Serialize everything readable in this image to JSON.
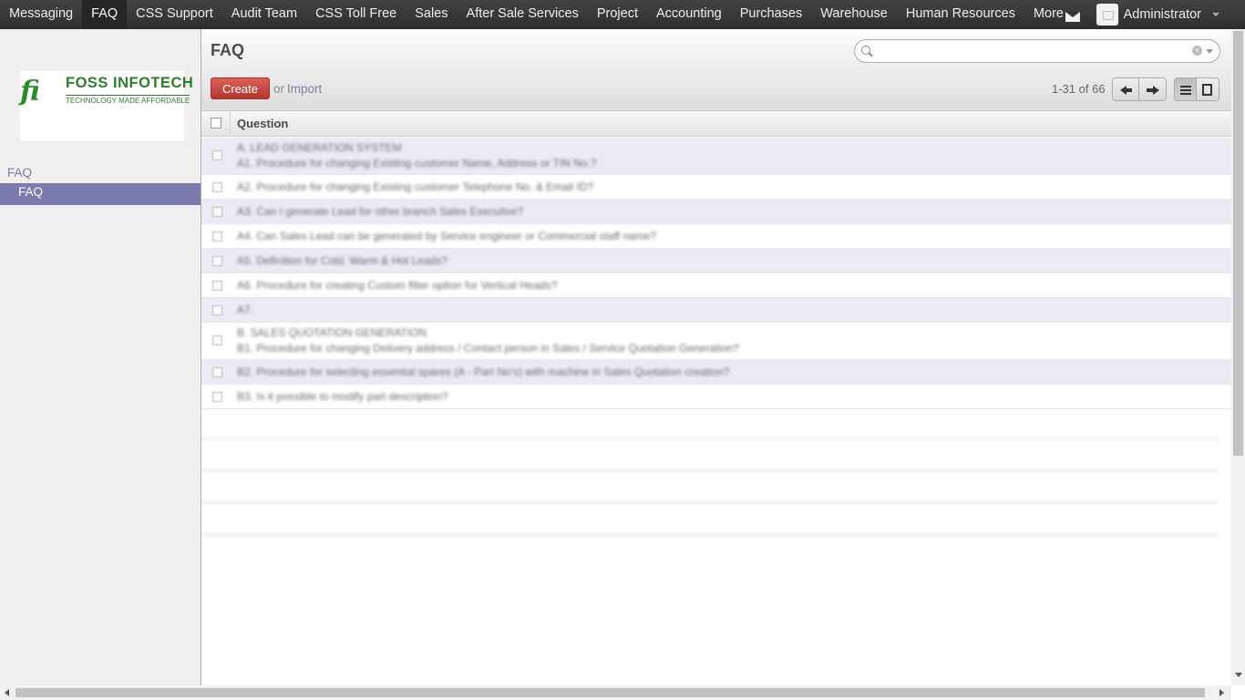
{
  "topbar": {
    "menu": [
      {
        "label": "Messaging",
        "active": false
      },
      {
        "label": "FAQ",
        "active": true
      },
      {
        "label": "CSS Support",
        "active": false
      },
      {
        "label": "Audit Team",
        "active": false
      },
      {
        "label": "CSS Toll Free",
        "active": false
      },
      {
        "label": "Sales",
        "active": false
      },
      {
        "label": "After Sale Services",
        "active": false
      },
      {
        "label": "Project",
        "active": false
      },
      {
        "label": "Accounting",
        "active": false
      },
      {
        "label": "Purchases",
        "active": false
      },
      {
        "label": "Warehouse",
        "active": false
      },
      {
        "label": "Human Resources",
        "active": false
      }
    ],
    "more_label": "More",
    "user_name": "Administrator"
  },
  "sidebar": {
    "logo": {
      "title": "FOSS INFOTECH",
      "tagline": "TECHNOLOGY MADE AFFORDABLE"
    },
    "section_header": "FAQ",
    "items": [
      {
        "label": "FAQ",
        "selected": true
      }
    ]
  },
  "control_panel": {
    "title": "FAQ",
    "search": {
      "value": "",
      "placeholder": ""
    },
    "create_label": "Create",
    "or_text": "or",
    "import_label": "Import",
    "pager": "1-31 of 66"
  },
  "list": {
    "columns": [
      "Question"
    ],
    "rows": [
      {
        "lines": [
          "A. LEAD GENERATION SYSTEM",
          "A1. Procedure for changing Existing customer Name, Address or TIN No.?"
        ]
      },
      {
        "lines": [
          "A2. Procedure for changing Existing customer Telephone No. & Email ID?"
        ]
      },
      {
        "lines": [
          "A3. Can I generate Lead for other branch Sales Executive?"
        ]
      },
      {
        "lines": [
          "A4. Can Sales Lead can be generated by Service engineer or Commercial staff name?"
        ]
      },
      {
        "lines": [
          "A5. Definition for Cold, Warm & Hot Leads?"
        ]
      },
      {
        "lines": [
          "A6. Procedure for creating Custom filter option for Vertical Heads?"
        ]
      },
      {
        "lines": [
          "A7."
        ]
      },
      {
        "lines": [
          "B. SALES QUOTATION GENERATION",
          "B1. Procedure for changing Delivery address / Contact person in Sales / Service Quotation Generation?"
        ]
      },
      {
        "lines": [
          "B2. Procedure for selecting essential spares (A - Part No's) with machine in Sales Quotation creation?"
        ]
      },
      {
        "lines": [
          "B3. Is it possible to modify part description?"
        ]
      }
    ]
  },
  "colors": {
    "topbar": "#3a3939",
    "accent": "#7c7bad",
    "create_button": "#c9312b",
    "logo_green": "#2e7d2e",
    "row_alt": "#ebebf5"
  }
}
